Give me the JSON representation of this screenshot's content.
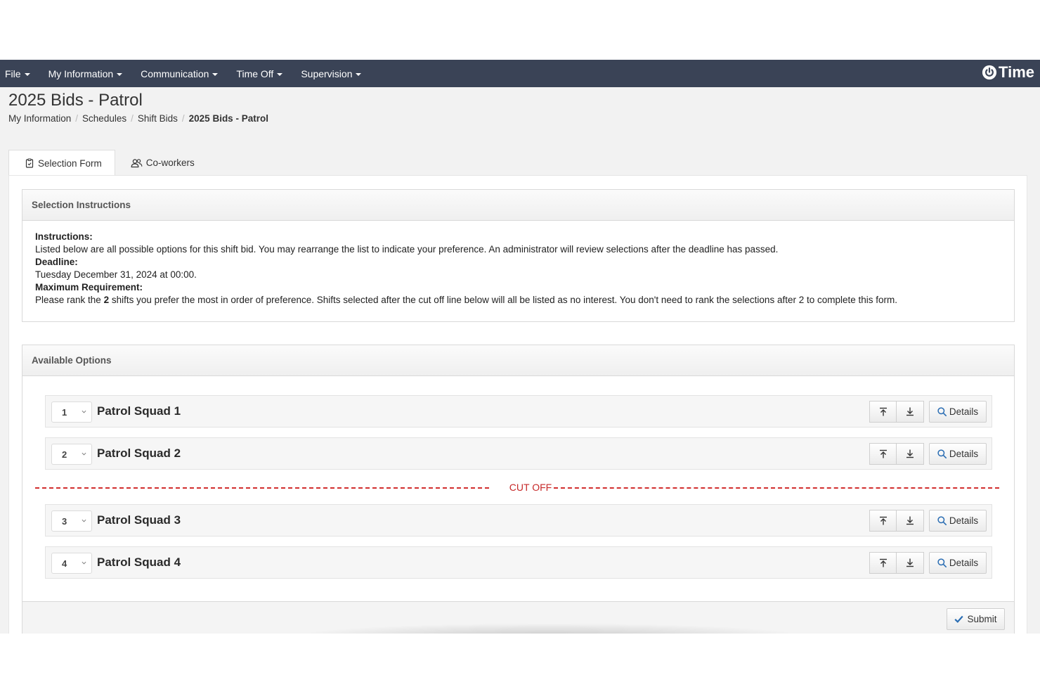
{
  "navbar": {
    "menus": [
      {
        "label": "File"
      },
      {
        "label": "My Information"
      },
      {
        "label": "Communication"
      },
      {
        "label": "Time Off"
      },
      {
        "label": "Supervision"
      }
    ],
    "brand": "Time",
    "brand_icon": "power-icon"
  },
  "page": {
    "title": "2025 Bids - Patrol",
    "breadcrumb": [
      "My Information",
      "Schedules",
      "Shift Bids",
      "2025 Bids - Patrol"
    ]
  },
  "tabs": [
    {
      "label": "Selection Form",
      "icon": "clipboard-icon",
      "active": true
    },
    {
      "label": "Co-workers",
      "icon": "users-icon",
      "active": false
    }
  ],
  "instructions": {
    "heading": "Selection Instructions",
    "instructions_label": "Instructions:",
    "instructions_text": "Listed below are all possible options for this shift bid. You may rearrange the list to indicate your preference. An administrator will review selections after the deadline has passed.",
    "deadline_label": "Deadline:",
    "deadline_text": "Tuesday December 31, 2024 at 00:00.",
    "max_label": "Maximum Requirement:",
    "max_prefix": "Please rank the ",
    "max_count": "2",
    "max_suffix": " shifts you prefer the most in order of preference. Shifts selected after the cut off line below will all be listed as no interest. You don't need to rank the selections after 2 to complete this form."
  },
  "options": {
    "heading": "Available Options",
    "items": [
      {
        "rank": "1",
        "name": "Patrol Squad 1",
        "details_label": "Details"
      },
      {
        "rank": "2",
        "name": "Patrol Squad 2",
        "details_label": "Details"
      },
      {
        "rank": "3",
        "name": "Patrol Squad 3",
        "details_label": "Details"
      },
      {
        "rank": "4",
        "name": "Patrol Squad 4",
        "details_label": "Details"
      }
    ],
    "cutoff_label": "CUT OFF",
    "submit_label": "Submit"
  },
  "colors": {
    "navbar": "#3a4356",
    "cutoff": "#c62828",
    "accent": "#2a6db3"
  }
}
